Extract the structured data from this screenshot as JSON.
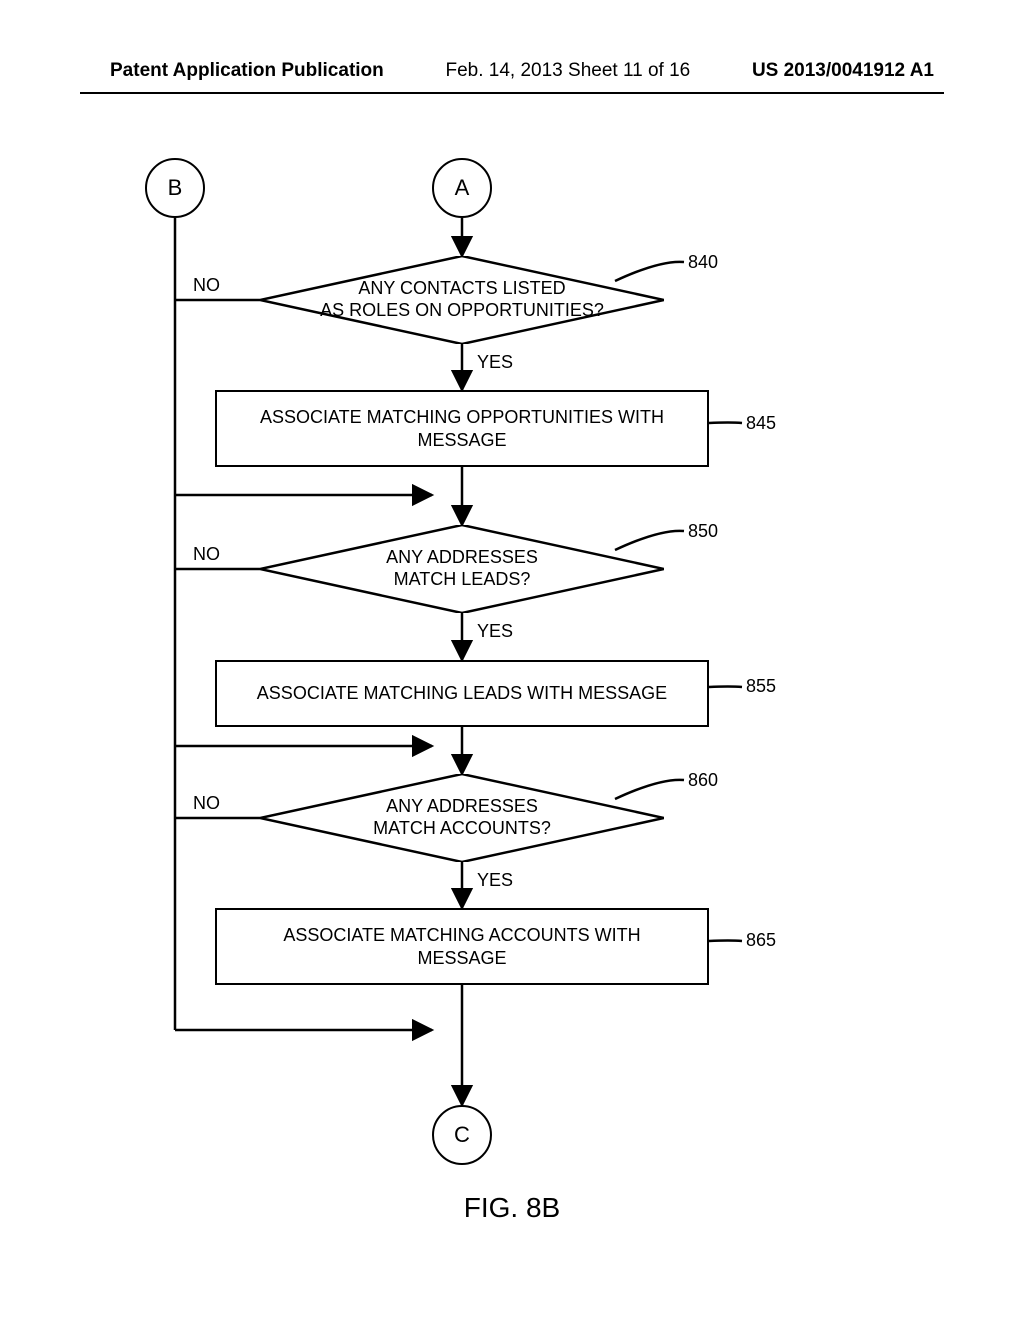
{
  "header": {
    "left": "Patent Application Publication",
    "mid": "Feb. 14, 2013  Sheet 11 of 16",
    "right": "US 2013/0041912 A1"
  },
  "connectors": {
    "b": "B",
    "a": "A",
    "c": "C"
  },
  "decisions": {
    "d840": {
      "ref": "840",
      "text": "ANY CONTACTS LISTED\nAS ROLES ON OPPORTUNITIES?"
    },
    "d850": {
      "ref": "850",
      "text": "ANY ADDRESSES\nMATCH LEADS?"
    },
    "d860": {
      "ref": "860",
      "text": "ANY ADDRESSES\nMATCH ACCOUNTS?"
    }
  },
  "processes": {
    "p845": {
      "ref": "845",
      "text": "ASSOCIATE MATCHING OPPORTUNITIES WITH MESSAGE"
    },
    "p855": {
      "ref": "855",
      "text": "ASSOCIATE MATCHING LEADS WITH MESSAGE"
    },
    "p865": {
      "ref": "865",
      "text": "ASSOCIATE MATCHING ACCOUNTS WITH MESSAGE"
    }
  },
  "labels": {
    "yes": "YES",
    "no": "NO"
  },
  "figure_caption": "FIG. 8B"
}
